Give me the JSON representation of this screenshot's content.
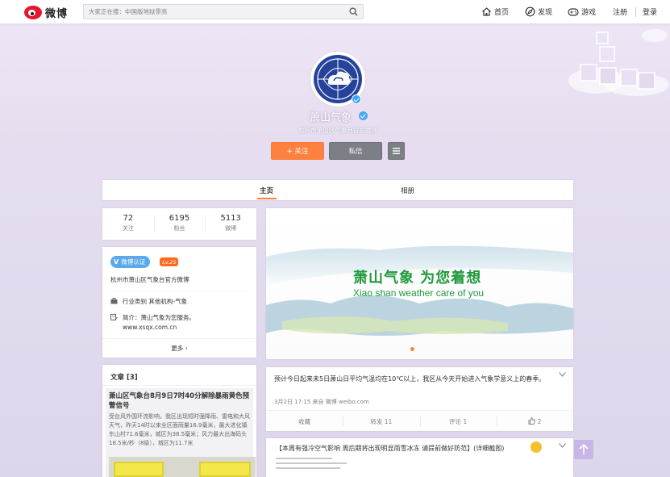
{
  "header": {
    "logo_text": "微博",
    "search_placeholder": "大家正在搜：中国版地狱景亮",
    "nav": [
      {
        "label": "首页",
        "icon": "home-icon"
      },
      {
        "label": "发现",
        "icon": "discover-icon"
      },
      {
        "label": "游戏",
        "icon": "game-icon"
      },
      {
        "label": "注册"
      },
      {
        "label": "登录"
      }
    ]
  },
  "profile": {
    "name": "萧山气象",
    "bio": "杭州市萧山区气象台官方微博",
    "follow_label": "+ 关注",
    "message_label": "私信"
  },
  "tabs": [
    "主页",
    "相册"
  ],
  "stats": [
    {
      "value": "72",
      "label": "关注"
    },
    {
      "value": "6195",
      "label": "粉丝"
    },
    {
      "value": "5113",
      "label": "微博"
    }
  ],
  "info": {
    "verified_label": "微博认证",
    "level": "Lv.25",
    "description": "杭州市萧山区气象台官方微博",
    "industry": "行业类别  其他机构-气象",
    "intro_label": "简介：",
    "intro_text": "萧山气象为您服务。",
    "website": "www.xsqx.com.cn",
    "more_label": "更多"
  },
  "articles": {
    "title": "文章 [3]",
    "headline": "萧山区气象台8月9日7时40分解除暴雨黄色预警信号",
    "excerpt": "受台风外围环流影响，我区出现短时强降雨、雷电和大风天气，昨天14时以来全区面雨量16.9毫米，最大进化镇东山村71.6毫米，城区为38.5毫米；风力最大出海码头18.5米/秒（8级），城区为11.7米"
  },
  "banner": {
    "title": "萧山气象  为您着想",
    "subtitle": "Xiao  shan weather care of you"
  },
  "post": {
    "text": "预计今日起来未5日萧山日平均气温均在10℃以上，我区从今天开始进入气象学意义上的春季。",
    "meta": "3月2日 17:15 来自 微博 weibo.com",
    "actions": [
      "收藏",
      "转发 11",
      "评论 1",
      "2"
    ]
  },
  "post2": {
    "text": "【本周有强冷空气影响 周后期将出现明显雨雪冰冻 请提前做好防范】(详细截图)"
  },
  "colors": {
    "accent": "#ff8140",
    "brand_red": "#e6162d",
    "banner_green": "#1f9a3c",
    "verified_blue": "#5aaaea"
  }
}
